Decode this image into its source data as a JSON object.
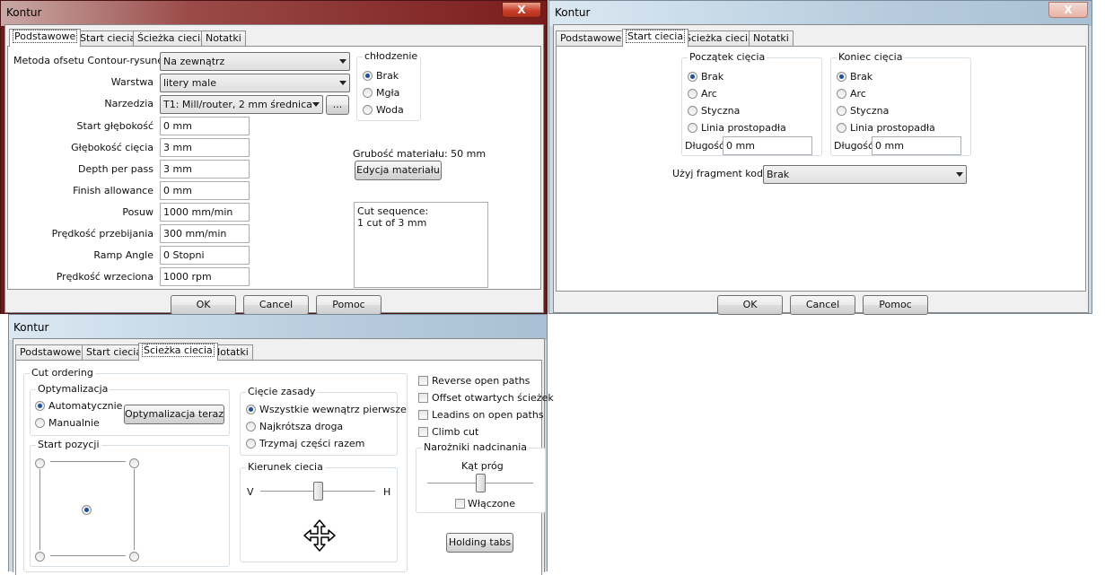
{
  "win1": {
    "title": "Kontur",
    "close": "X",
    "tabs": [
      "Podstawowe",
      "Start ciecia",
      "Ścieżka ciecia",
      "Notatki"
    ],
    "labels": {
      "offset_method": "Metoda ofsetu Contour-rysunek",
      "layer": "Warstwa",
      "tool": "Narzedzia",
      "start_depth": "Start głębokość",
      "cut_depth": "Głębokość cięcia",
      "depth_per_pass": "Depth per pass",
      "finish_allowance": "Finish allowance",
      "feed": "Posuw",
      "plunge": "Prędkość przebijania",
      "ramp_angle": "Ramp Angle",
      "spindle": "Prędkość wrzeciona"
    },
    "values": {
      "offset_method": "Na zewnątrz",
      "layer": "litery male",
      "tool": "T1: Mill/router, 2 mm średnica",
      "start_depth": "0 mm",
      "cut_depth": "3 mm",
      "depth_per_pass": "3 mm",
      "finish_allowance": "0 mm",
      "feed": "1000 mm/min",
      "plunge": "300 mm/min",
      "ramp_angle": "0 Stopni",
      "spindle": "1000 rpm"
    },
    "tool_browse": "...",
    "coolant": {
      "label": "chłodzenie",
      "options": [
        "Brak",
        "Mgła",
        "Woda"
      ],
      "selected": "Brak"
    },
    "material_thickness": "Grubość materiału: 50 mm",
    "edit_material": "Edycja materiału",
    "cut_sequence": "Cut sequence:\n1 cut of 3 mm",
    "buttons": {
      "ok": "OK",
      "cancel": "Cancel",
      "help": "Pomoc"
    }
  },
  "win2": {
    "title": "Kontur",
    "close": "X",
    "tabs": [
      "Podstawowe",
      "Start ciecia",
      "Ścieżka ciecia",
      "Notatki"
    ],
    "start": {
      "label": "Początek cięcia",
      "options": [
        "Brak",
        "Arc",
        "Styczna",
        "Linia prostopadła"
      ],
      "selected": "Brak",
      "length_label": "Długość",
      "length_value": "0 mm"
    },
    "end": {
      "label": "Koniec cięcia",
      "options": [
        "Brak",
        "Arc",
        "Styczna",
        "Linia prostopadła"
      ],
      "selected": "Brak",
      "length_label": "Długość",
      "length_value": "0 mm"
    },
    "snippet_label": "Użyj fragment kodu",
    "snippet_value": "Brak",
    "buttons": {
      "ok": "OK",
      "cancel": "Cancel",
      "help": "Pomoc"
    }
  },
  "win3": {
    "title": "Kontur",
    "tabs": [
      "Podstawowe",
      "Start ciecia",
      "Ścieżka ciecia",
      "Notatki"
    ],
    "cut_ordering": "Cut ordering",
    "optimization": {
      "label": "Optymalizacja",
      "options": [
        "Automatycznie",
        "Manualnie"
      ],
      "selected": "Automatycznie",
      "button": "Optymalizacja teraz"
    },
    "start_position": "Start pozycji",
    "cut_rule": {
      "label": "Cięcie zasady",
      "options": [
        "Wszystkie wewnątrz pierwsze",
        "Najkrótsza droga",
        "Trzymaj części razem"
      ],
      "selected": "Wszystkie wewnątrz pierwsze"
    },
    "direction": {
      "label": "Kierunek ciecia",
      "left": "V",
      "right": "H",
      "value": 0.5
    },
    "checks": [
      "Reverse open paths",
      "Offset otwartych ścieżek",
      "Leadins on open paths",
      "Climb cut"
    ],
    "corners": {
      "label": "Narożniki nadcinania",
      "angle_label": "Kąt próg",
      "angle_value": 0.5,
      "enabled_label": "Włączone"
    },
    "holding_tabs": "Holding tabs"
  }
}
